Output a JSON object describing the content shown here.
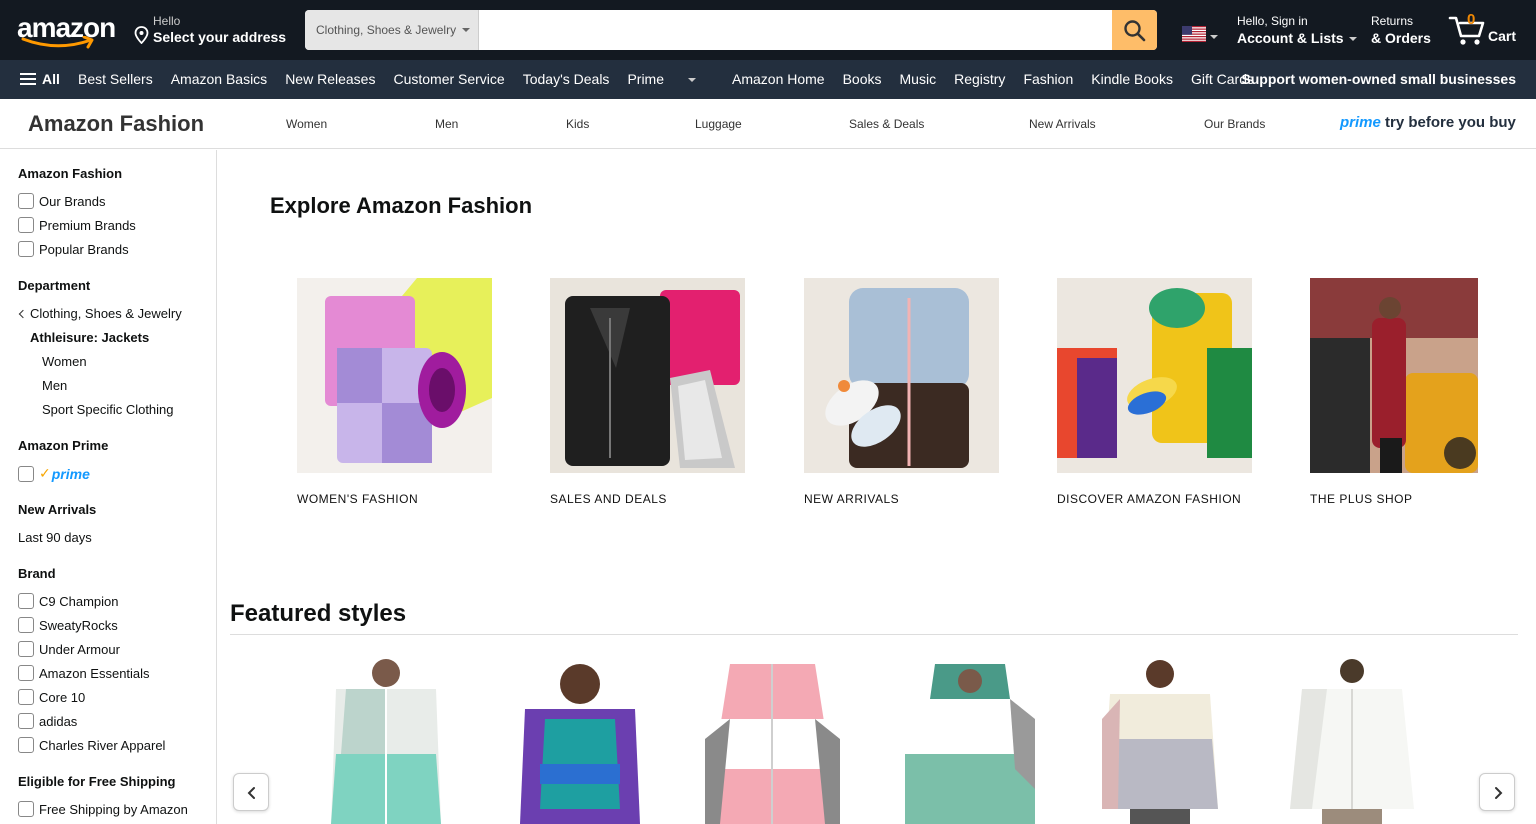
{
  "header": {
    "logo_text": "amazon",
    "address_line1": "Hello",
    "address_line2": "Select your address",
    "search_category": "Clothing, Shoes & Jewelry",
    "search_placeholder": "",
    "account_line1": "Hello, Sign in",
    "account_line2": "Account & Lists",
    "returns_line1": "Returns",
    "returns_line2": "& Orders",
    "cart_count": "0",
    "cart_label": "Cart"
  },
  "subnav": {
    "all_label": "All",
    "links": [
      "Best Sellers",
      "Amazon Basics",
      "New Releases",
      "Customer Service",
      "Today's Deals",
      "Prime",
      "Amazon Home",
      "Books",
      "Music",
      "Registry",
      "Fashion",
      "Kindle Books",
      "Gift Cards"
    ],
    "promo": "Support women-owned small businesses"
  },
  "fashion_bar": {
    "brand": "Amazon Fashion",
    "links": [
      "Women",
      "Men",
      "Kids",
      "Luggage",
      "Sales & Deals",
      "New Arrivals",
      "Our Brands"
    ],
    "prime_word": "prime",
    "prime_tagline": "try before you buy"
  },
  "sidebar": {
    "sections": [
      {
        "heading": "Amazon Fashion",
        "checkboxes": [
          "Our Brands",
          "Premium Brands",
          "Popular Brands"
        ]
      },
      {
        "heading": "Department",
        "back_link": "Clothing, Shoes & Jewelry",
        "current": "Athleisure: Jackets",
        "children": [
          "Women",
          "Men",
          "Sport Specific Clothing"
        ]
      },
      {
        "heading": "Amazon Prime",
        "prime_label": "prime"
      },
      {
        "heading": "New Arrivals",
        "option": "Last 90 days"
      },
      {
        "heading": "Brand",
        "checkboxes": [
          "C9 Champion",
          "SweatyRocks",
          "Under Armour",
          "Amazon Essentials",
          "Core 10",
          "adidas",
          "Charles River Apparel"
        ]
      },
      {
        "heading": "Eligible for Free Shipping",
        "checkboxes": [
          "Free Shipping by Amazon"
        ]
      }
    ]
  },
  "main": {
    "explore_title": "Explore Amazon Fashion",
    "tiles": [
      {
        "caption": "WOMEN'S FASHION"
      },
      {
        "caption": "SALES AND DEALS"
      },
      {
        "caption": "NEW ARRIVALS"
      },
      {
        "caption": "DISCOVER AMAZON FASHION"
      },
      {
        "caption": "THE PLUS SHOP"
      }
    ],
    "featured_title": "Featured styles"
  },
  "colors": {
    "nav_dark": "#131921",
    "nav_secondary": "#232f3e",
    "search_button": "#febd69",
    "cart_count": "#f08804",
    "prime_blue": "#1399ff"
  }
}
